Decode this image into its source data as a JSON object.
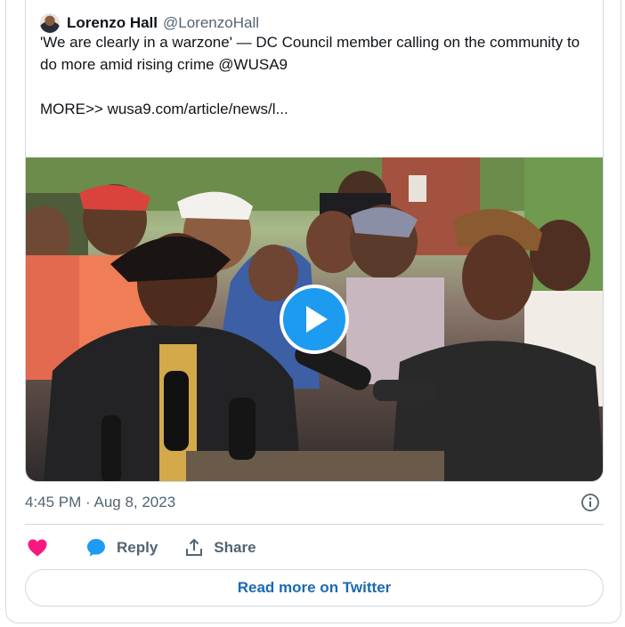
{
  "quoted_tweet": {
    "author_name": "Lorenzo Hall",
    "author_handle": "@LorenzoHall",
    "text": "'We are clearly in a warzone'  — DC Council member calling on the community to do more amid rising crime @WUSA9\n\nMORE>> wusa9.com/article/news/l...",
    "media": {
      "type": "video",
      "play_icon": "play-icon"
    }
  },
  "timestamp": "4:45 PM · Aug 8, 2023",
  "actions": {
    "like_icon": "heart-icon",
    "reply_icon": "reply-bubble-icon",
    "reply_label": "Reply",
    "share_icon": "share-upload-icon",
    "share_label": "Share"
  },
  "info_icon": "info-icon",
  "read_more_label": "Read more on Twitter",
  "colors": {
    "accent": "#1d9bf0",
    "like": "#f91880",
    "link": "#1a6ab2",
    "secondary_text": "#536471",
    "border": "#cfd9de"
  }
}
